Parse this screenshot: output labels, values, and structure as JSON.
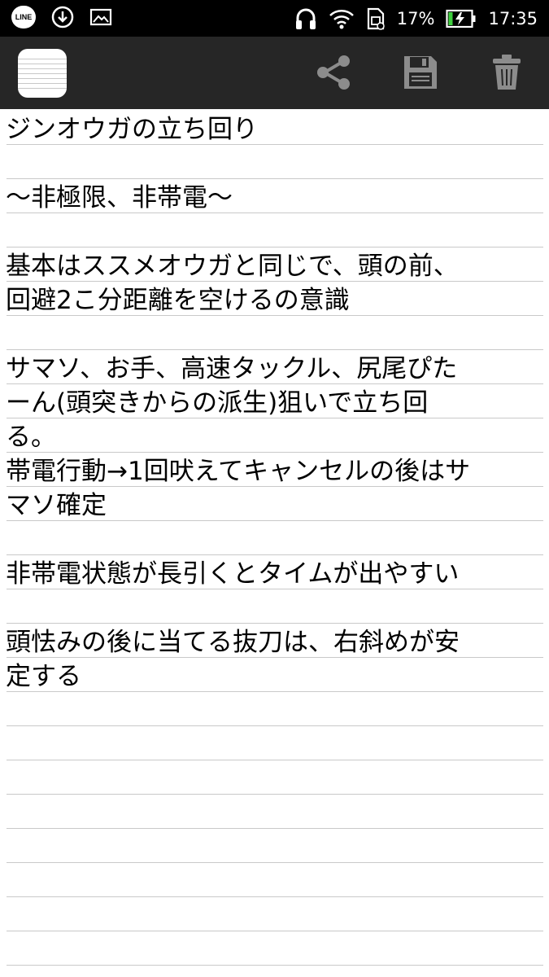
{
  "status_bar": {
    "line_label": "LINE",
    "battery_percent": "17%",
    "time": "17:35",
    "icons": [
      "line-app-icon",
      "download-icon",
      "image-icon",
      "headphones-icon",
      "wifi-icon",
      "sim-card-icon",
      "battery-charging-icon"
    ]
  },
  "toolbar": {
    "icons": [
      "notepad-app-icon",
      "share-icon",
      "save-icon",
      "trash-icon"
    ],
    "icon_color": "#8c8c8c",
    "background": "#262626"
  },
  "note": {
    "lines": [
      "ジンオウガの立ち回り",
      "",
      "〜非極限、非帯電〜",
      "",
      "基本はススメオウガと同じで、頭の前、",
      "回避2こ分距離を空けるの意識",
      "",
      "サマソ、お手、高速タックル、尻尾ぴた",
      "ーん(頭突きからの派生)狙いで立ち回",
      "る。",
      "帯電行動→1回吠えてキャンセルの後はサ",
      "マソ確定",
      "",
      "非帯電状態が長引くとタイムが出やすい",
      "",
      "頭怯みの後に当てる抜刀は、右斜めが安",
      "定する"
    ]
  }
}
